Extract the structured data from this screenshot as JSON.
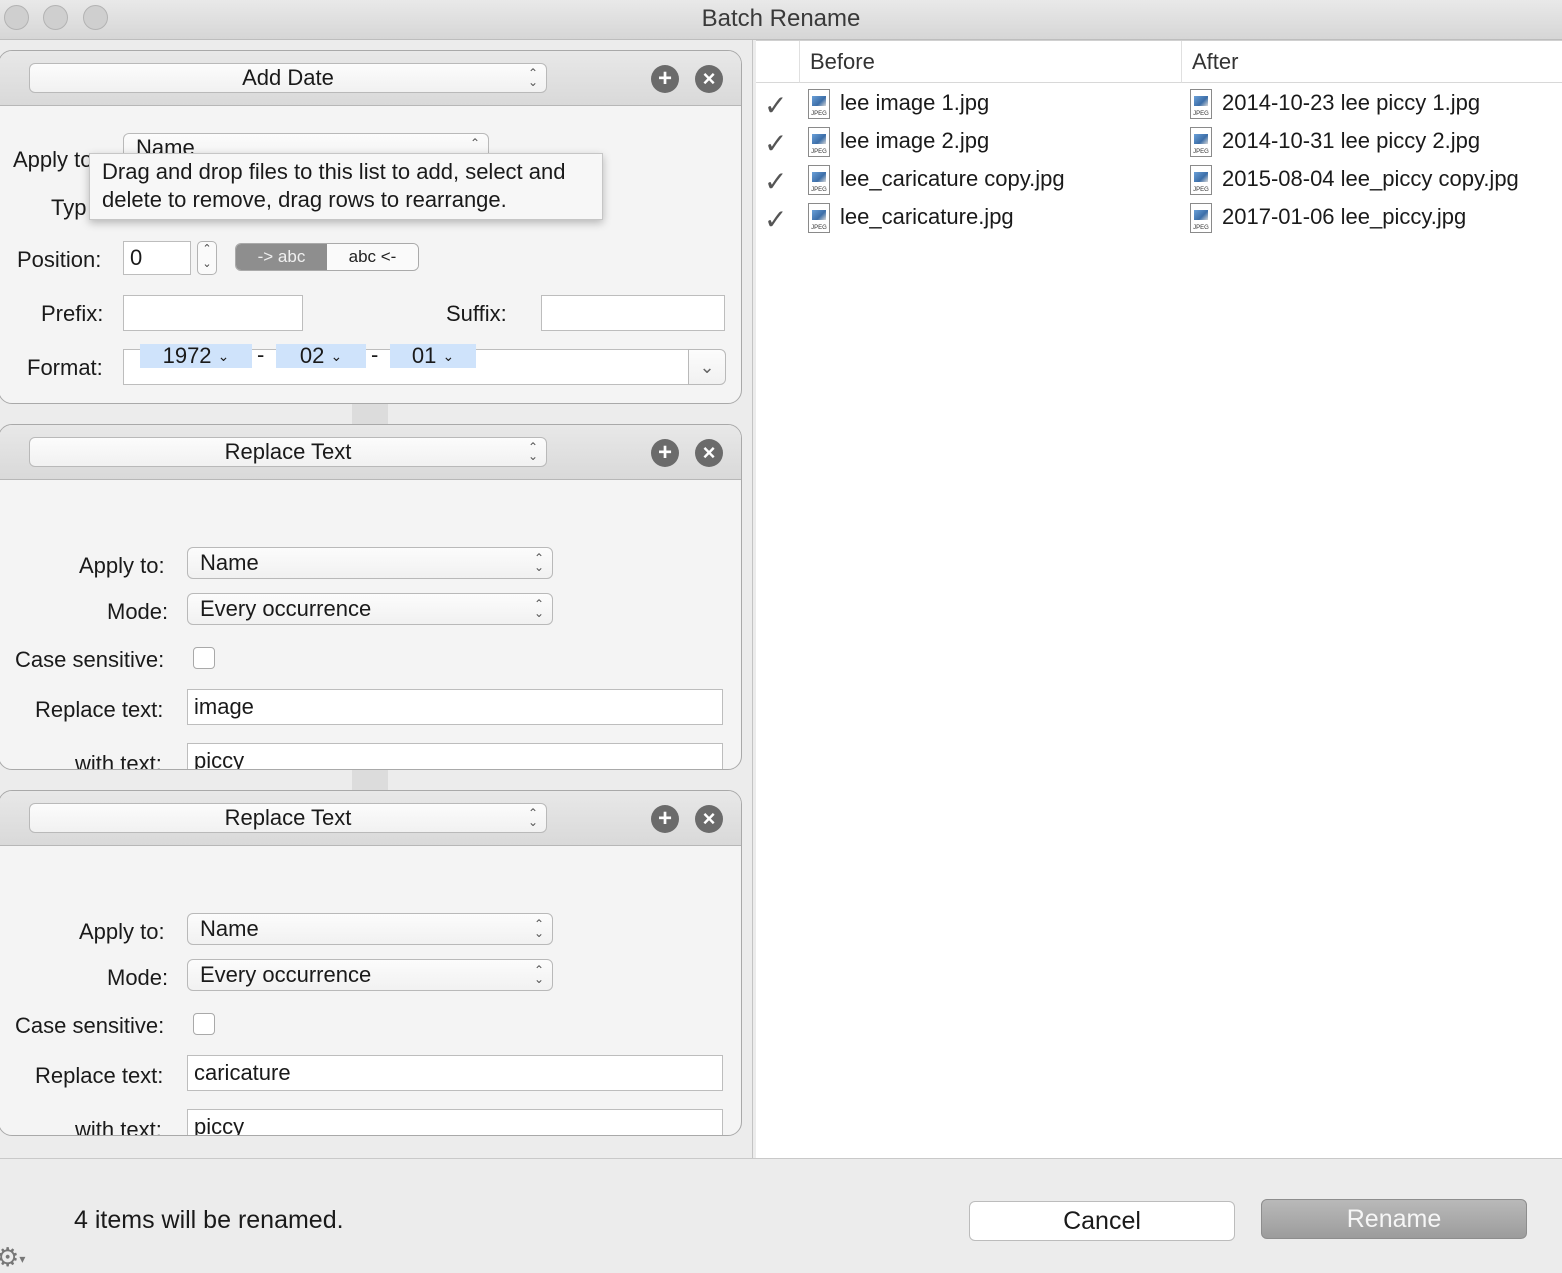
{
  "window": {
    "title": "Batch Rename"
  },
  "tooltip": {
    "text": "Drag and drop files to this list to add, select and delete to remove, drag rows to rearrange."
  },
  "add_date": {
    "action": "Add Date",
    "apply_to_label": "Apply to:",
    "apply_to_value": "Name",
    "type_label": "Typ",
    "position_label": "Position:",
    "position_value": "0",
    "seg_after": "-> abc",
    "seg_before": "abc <-",
    "prefix_label": "Prefix:",
    "suffix_label": "Suffix:",
    "prefix_value": "",
    "suffix_value": "",
    "format_label": "Format:",
    "format_tokens": [
      "1972",
      "02",
      "01"
    ],
    "format_separator": "-"
  },
  "replace1": {
    "action": "Replace Text",
    "apply_to_label": "Apply to:",
    "apply_to_value": "Name",
    "mode_label": "Mode:",
    "mode_value": "Every occurrence",
    "case_label": "Case sensitive:",
    "replace_label": "Replace text:",
    "replace_value": "image",
    "with_label": "with text:",
    "with_value": "piccy"
  },
  "replace2": {
    "action": "Replace Text",
    "apply_to_label": "Apply to:",
    "apply_to_value": "Name",
    "mode_label": "Mode:",
    "mode_value": "Every occurrence",
    "case_label": "Case sensitive:",
    "replace_label": "Replace text:",
    "replace_value": "caricature",
    "with_label": "with text:",
    "with_value": "piccy"
  },
  "file_list": {
    "col_before": "Before",
    "col_after": "After",
    "file_badge": "JPEG",
    "rows": [
      {
        "before": "lee image 1.jpg",
        "after": "2014-10-23 lee piccy 1.jpg"
      },
      {
        "before": "lee image 2.jpg",
        "after": "2014-10-31 lee piccy 2.jpg"
      },
      {
        "before": "lee_caricature copy.jpg",
        "after": "2015-08-04 lee_piccy copy.jpg"
      },
      {
        "before": "lee_caricature.jpg",
        "after": "2017-01-06 lee_piccy.jpg"
      }
    ]
  },
  "footer": {
    "status": "4 items will be renamed.",
    "cancel": "Cancel",
    "rename": "Rename"
  },
  "icons": {
    "add": "plus-circle-icon",
    "remove": "close-circle-icon",
    "check": "checkmark-icon",
    "settings": "gear-icon"
  }
}
